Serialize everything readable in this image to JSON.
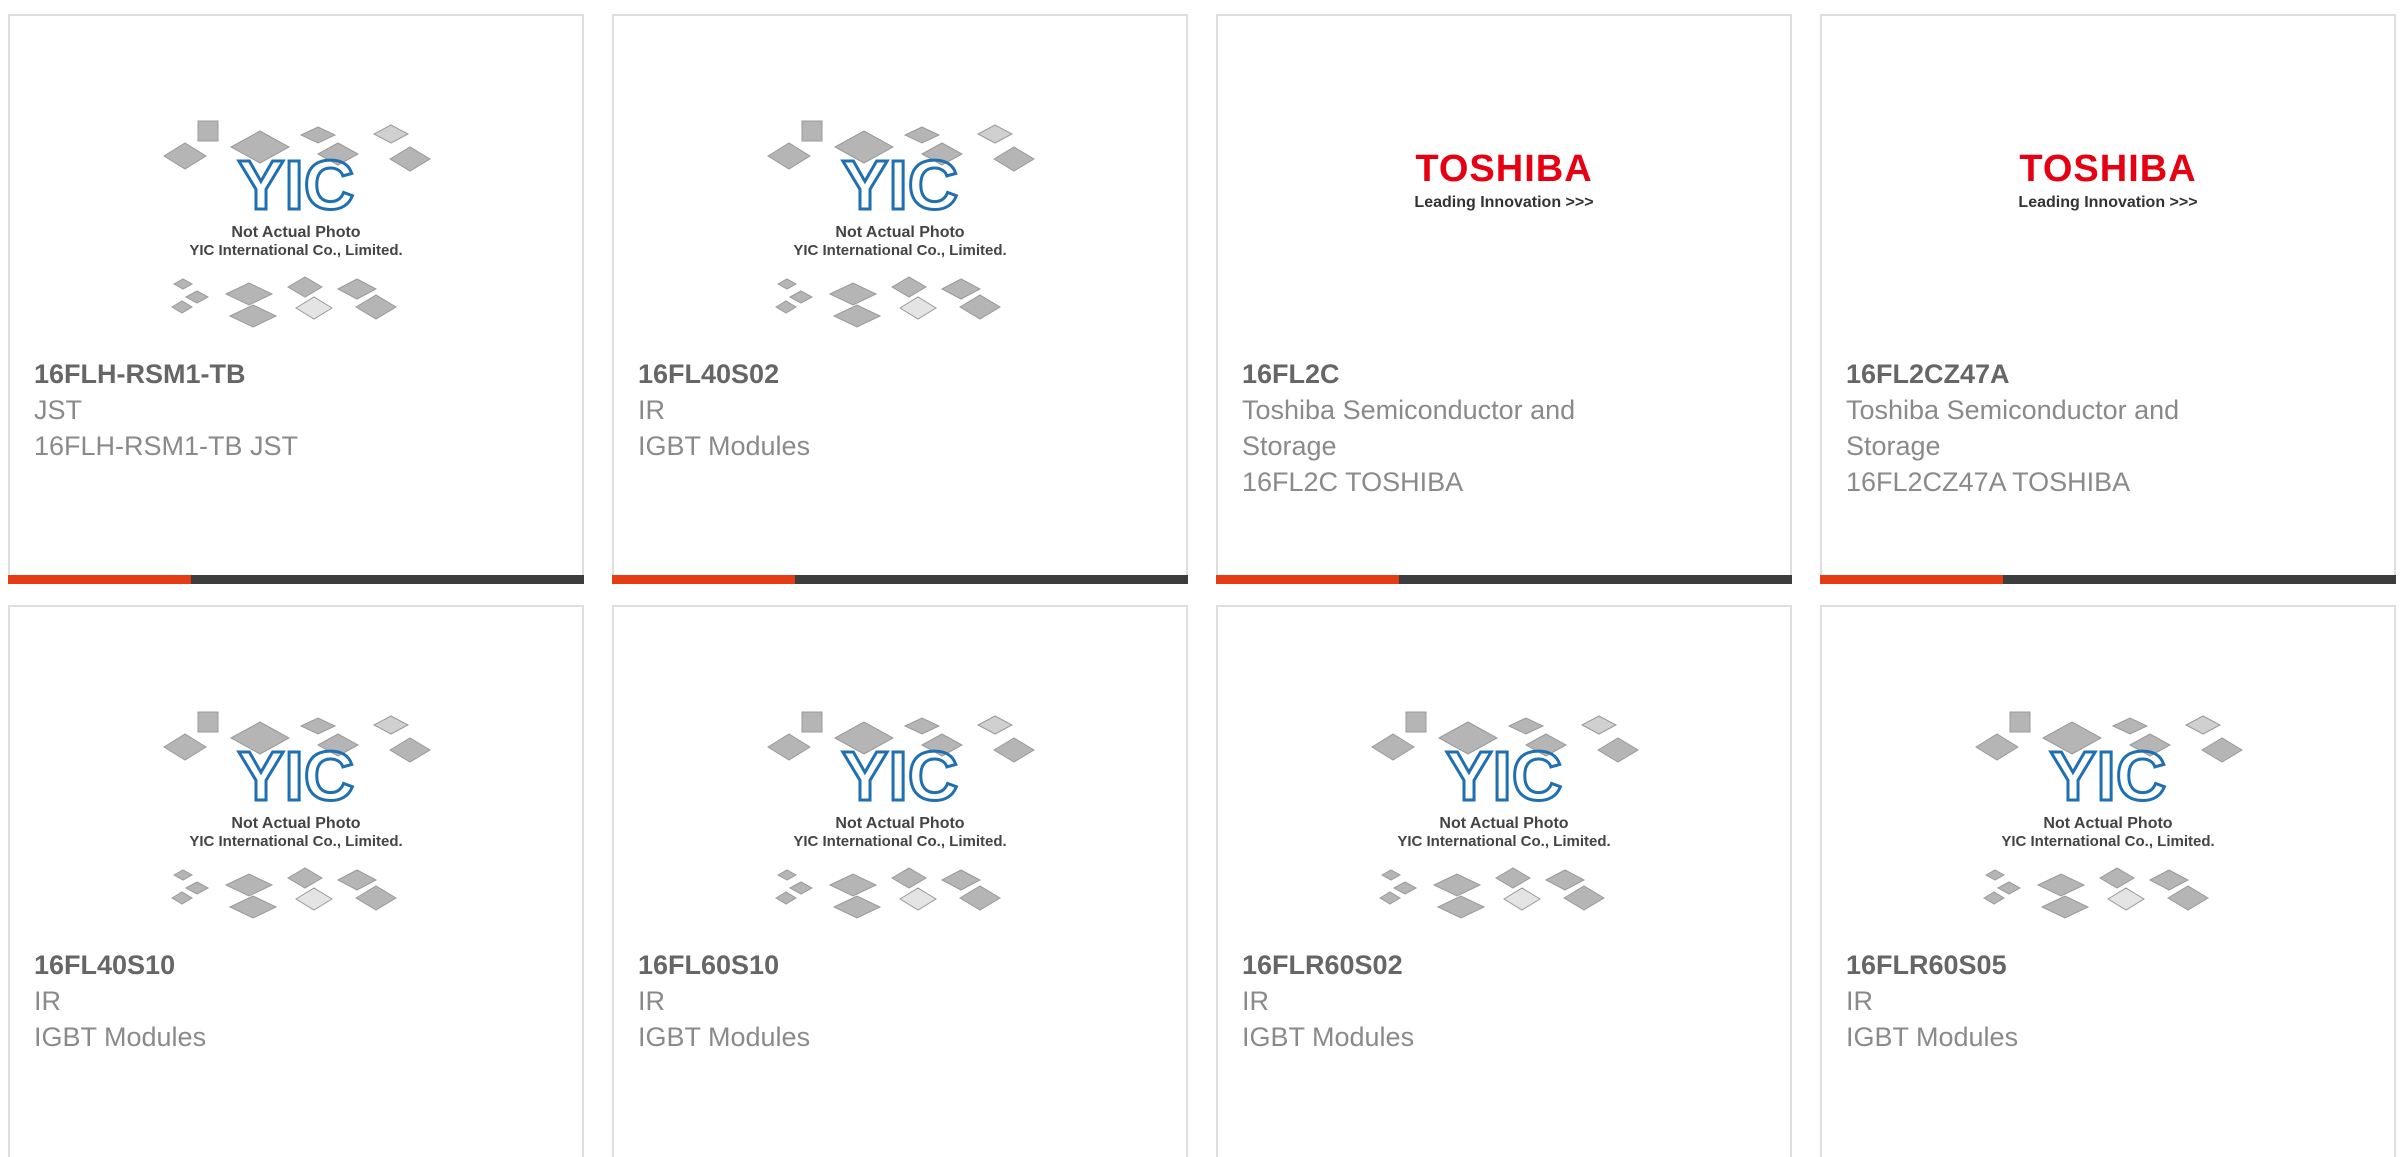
{
  "placeholder": {
    "logo_text": "YIC",
    "line1": "Not Actual Photo",
    "line2": "YIC International Co., Limited.",
    "logo_color": "#1f6fb2"
  },
  "toshiba": {
    "brand": "TOSHIBA",
    "tagline": "Leading Innovation >>>",
    "brand_color": "#e60012"
  },
  "colors": {
    "accent": "#e43c13",
    "bar": "#3d3d3d",
    "border": "#dedede"
  },
  "products": [
    {
      "part": "16FLH-RSM1-TB",
      "manufacturer": "JST",
      "description": "16FLH-RSM1-TB JST",
      "image": "placeholder"
    },
    {
      "part": "16FL40S02",
      "manufacturer": "IR",
      "description": "IGBT Modules",
      "image": "placeholder"
    },
    {
      "part": "16FL2C",
      "manufacturer": "Toshiba Semiconductor and Storage",
      "description": "16FL2C TOSHIBA",
      "image": "toshiba"
    },
    {
      "part": "16FL2CZ47A",
      "manufacturer": "Toshiba Semiconductor and Storage",
      "description": "16FL2CZ47A TOSHIBA",
      "image": "toshiba"
    },
    {
      "part": "16FL40S10",
      "manufacturer": "IR",
      "description": "IGBT Modules",
      "image": "placeholder"
    },
    {
      "part": "16FL60S10",
      "manufacturer": "IR",
      "description": "IGBT Modules",
      "image": "placeholder"
    },
    {
      "part": "16FLR60S02",
      "manufacturer": "IR",
      "description": "IGBT Modules",
      "image": "placeholder"
    },
    {
      "part": "16FLR60S05",
      "manufacturer": "IR",
      "description": "IGBT Modules",
      "image": "placeholder"
    }
  ]
}
